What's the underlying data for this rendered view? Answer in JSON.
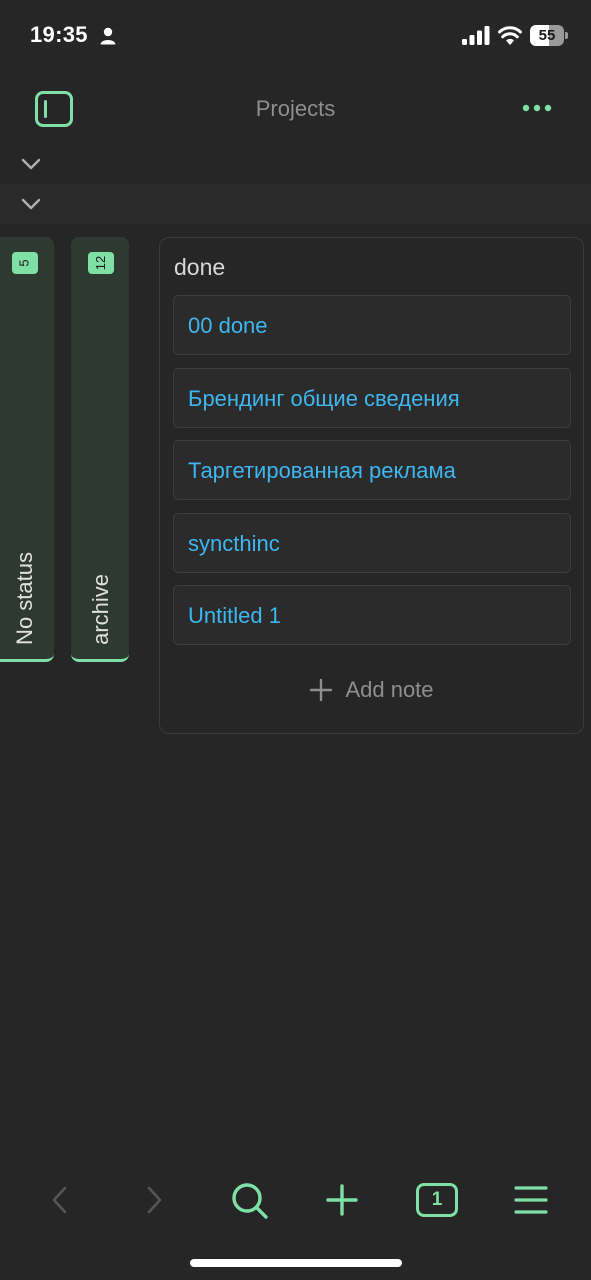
{
  "status_bar": {
    "time": "19:35",
    "battery": "55",
    "battery_level": 0.55
  },
  "header": {
    "title": "Projects"
  },
  "columns": [
    {
      "label": "No status",
      "count": "5"
    },
    {
      "label": "archive",
      "count": "12"
    }
  ],
  "done_column": {
    "title": "done",
    "notes": [
      "00 done",
      "Брендинг общие сведения",
      "Таргетированная реклама",
      "syncthinc",
      "Untitled 1"
    ],
    "add_label": "Add note"
  },
  "toolbar": {
    "tab_count": "1"
  },
  "colors": {
    "accent": "#7fe0a5",
    "link": "#3eb7f0",
    "background": "#262626"
  }
}
